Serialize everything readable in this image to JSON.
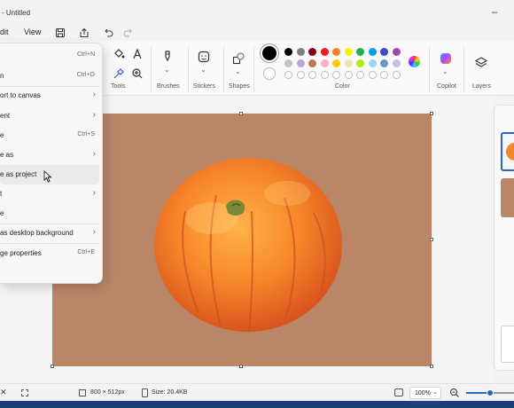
{
  "window": {
    "title": "- Untitled"
  },
  "menubar": {
    "items": [
      "dit",
      "View"
    ]
  },
  "ribbon": {
    "groups": {
      "tools": "Tools",
      "brushes": "Brushes",
      "stickers": "Stickers",
      "shapes": "Shapes",
      "color": "Color",
      "copilot": "Copilot",
      "layers": "Layers"
    },
    "palette_row1": [
      "#000000",
      "#7f7f7f",
      "#880015",
      "#ed1c24",
      "#ff7f27",
      "#fff200",
      "#22b14c",
      "#00a2e8",
      "#3f48cc",
      "#a349a4"
    ],
    "palette_row2": [
      "#c3c3c3",
      "#b5a7d6",
      "#b97a57",
      "#ffaec9",
      "#ffc90e",
      "#efe4b0",
      "#b5e61d",
      "#99d9ea",
      "#7092be",
      "#c8bfe7"
    ]
  },
  "file_menu": {
    "items": [
      {
        "label": "",
        "shortcut": "Ctrl+N",
        "submenu": false
      },
      {
        "label": "n",
        "shortcut": "Ctrl+O",
        "submenu": false
      },
      {
        "label": "ort to canvas",
        "shortcut": "",
        "submenu": true
      },
      {
        "label": "ent",
        "shortcut": "",
        "submenu": true
      },
      {
        "label": "e",
        "shortcut": "Ctrl+S",
        "submenu": false
      },
      {
        "label": "e as",
        "shortcut": "",
        "submenu": true
      },
      {
        "label": "e as project",
        "shortcut": "",
        "submenu": false
      },
      {
        "label": "t",
        "shortcut": "",
        "submenu": true
      },
      {
        "label": "e",
        "shortcut": "",
        "submenu": false
      },
      {
        "label": "as desktop background",
        "shortcut": "",
        "submenu": true
      },
      {
        "label": "ge properties",
        "shortcut": "Ctrl+E",
        "submenu": false
      }
    ]
  },
  "status": {
    "dimensions": "800 × 512px",
    "size": "Size: 20.4KB",
    "zoom": "100%"
  },
  "canvas": {
    "background": "#b98668"
  }
}
